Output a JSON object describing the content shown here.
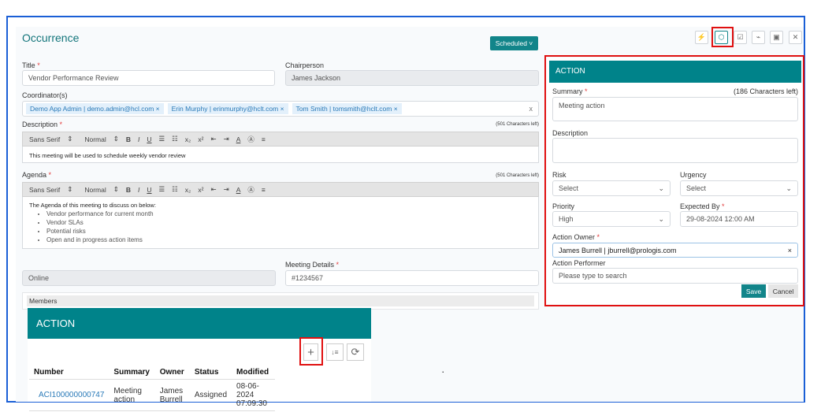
{
  "header": {
    "title": "Occurrence",
    "status_button": "Scheduled ˅"
  },
  "toolbar": {
    "icons": [
      "flash-icon",
      "cube-icon",
      "checkbox-icon",
      "trend-icon",
      "save-icon",
      "close-icon"
    ],
    "glyphs": [
      "⚡",
      "⬡",
      "☑",
      "⌁",
      "▣",
      "✕"
    ]
  },
  "form": {
    "title_label": "Title",
    "title_value": "Vendor Performance Review",
    "chair_label": "Chairperson",
    "chair_value": "James Jackson",
    "coord_label": "Coordinator(s)",
    "coordinators": [
      "Demo App Admin | demo.admin@hcl.com",
      "Erin Murphy | erinmurphy@hclt.com",
      "Tom Smith | tomsmith@hclt.com"
    ],
    "chip_remove": "×",
    "clear": "x",
    "desc_label": "Description",
    "desc_counter": "(501 Characters left)",
    "desc_text": "This meeting will be used to schedule weekly vendor review",
    "agenda_label": "Agenda",
    "agenda_counter": "(501 Characters left)",
    "agenda_intro": "The Agenda of this meeting to discuss on below:",
    "agenda_items": [
      "Vendor performance for current month",
      "Vendor SLAs",
      "Potential risks",
      "Open and in progress action items"
    ],
    "editor_font": "Sans Serif",
    "editor_size": "Normal",
    "editor_arrow": "⇕",
    "editor_buttons": [
      "B",
      "I",
      "U",
      "☰",
      "☷",
      "x₂",
      "x²",
      "⇤",
      "⇥",
      "A",
      "Ⓐ",
      "≡"
    ],
    "mode_value": "Online",
    "meeting_label": "Meeting Details",
    "meeting_value": "#1234567",
    "members_label": "Members",
    "required": "*"
  },
  "action_list": {
    "title": "ACTION",
    "buttons": [
      "+",
      "↓≡",
      "⟳"
    ],
    "columns": [
      "Number",
      "Summary",
      "Owner",
      "Status",
      "Modified"
    ],
    "rows": [
      [
        "ACI100000000747",
        "Meeting action",
        "James Burrell",
        "Assigned",
        "08-06-2024 07:09:30"
      ]
    ],
    "dot": "."
  },
  "action_form": {
    "title": "ACTION",
    "summary_label": "Summary",
    "summary_counter": "(186 Characters left)",
    "summary_value": "Meeting action",
    "description_label": "Description",
    "risk_label": "Risk",
    "risk_value": "Select",
    "urgency_label": "Urgency",
    "urgency_value": "Select",
    "priority_label": "Priority",
    "priority_value": "High",
    "expected_label": "Expected By",
    "expected_value": "29-08-2024 12:00 AM",
    "owner_label": "Action Owner",
    "owner_value": "James Burrell | jburrell@prologis.com",
    "owner_clear": "×",
    "performer_label": "Action Performer",
    "performer_placeholder": "Please type to search",
    "save": "Save",
    "cancel": "Cancel",
    "chevron": "⌄"
  },
  "colors": {
    "teal": "#00838a",
    "highlight": "#e01010",
    "frame": "#1a5fd6"
  }
}
